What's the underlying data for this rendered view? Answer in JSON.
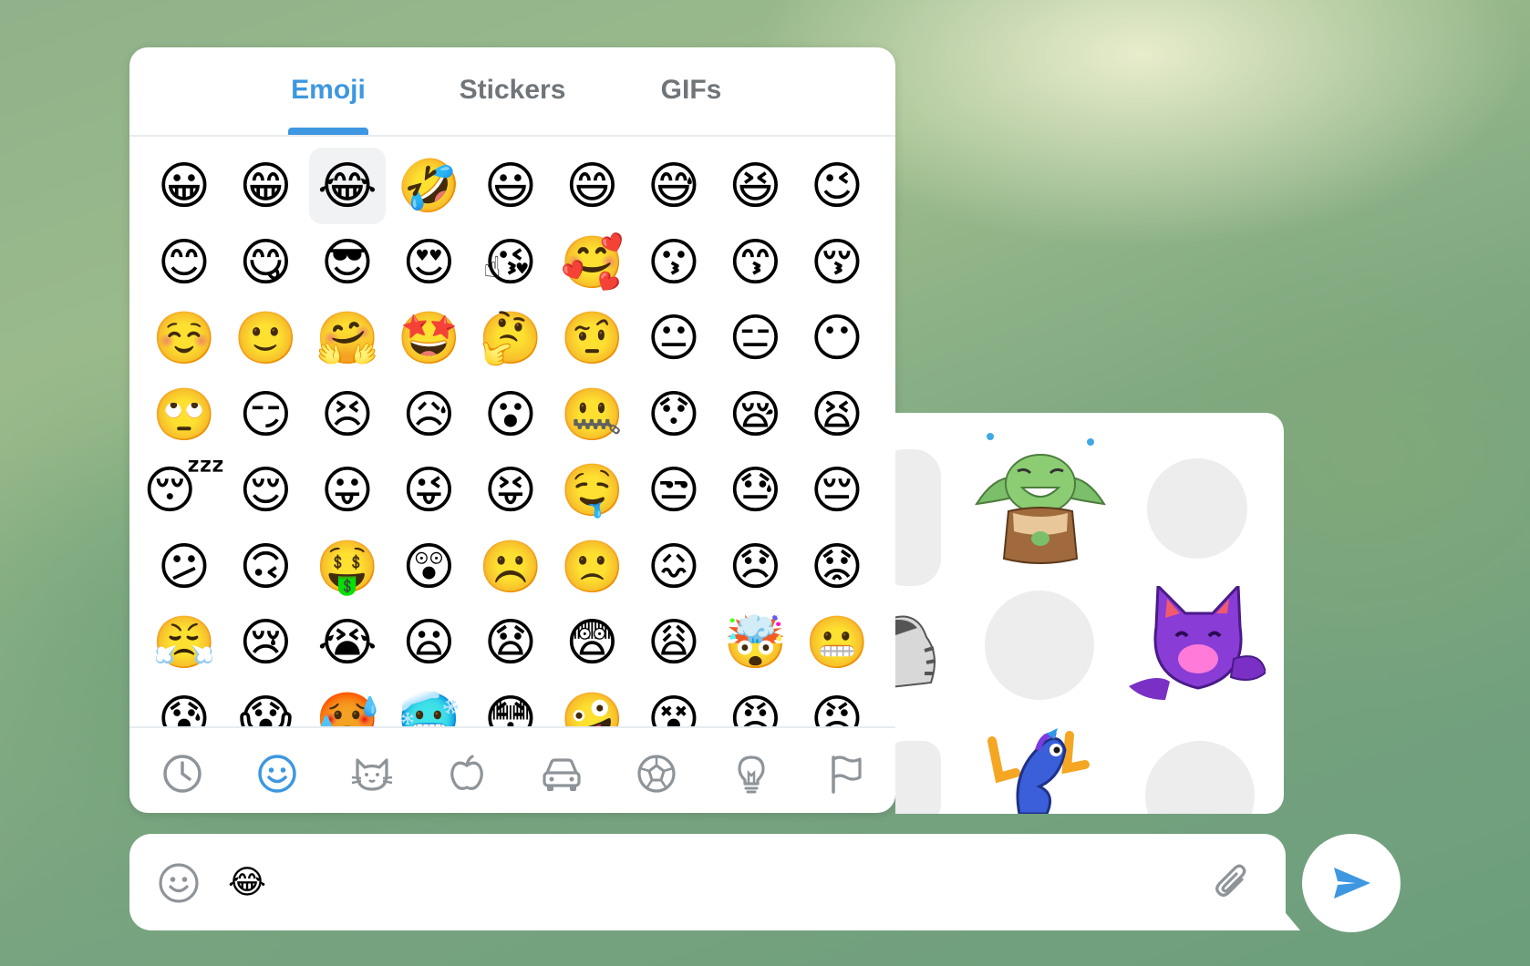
{
  "tabs": [
    {
      "label": "Emoji",
      "active": true
    },
    {
      "label": "Stickers",
      "active": false
    },
    {
      "label": "GIFs",
      "active": false
    }
  ],
  "emoji_grid": [
    [
      "😀",
      "😁",
      "😂",
      "🤣",
      "😃",
      "😄",
      "😅",
      "😆",
      "😉"
    ],
    [
      "😊",
      "😋",
      "😎",
      "😍",
      "😘",
      "🥰",
      "😗",
      "😙",
      "😚"
    ],
    [
      "☺️",
      "🙂",
      "🤗",
      "🤩",
      "🤔",
      "🤨",
      "😐",
      "😑",
      "😶"
    ],
    [
      "🙄",
      "😏",
      "😣",
      "😥",
      "😮",
      "🤐",
      "😯",
      "😪",
      "😫"
    ],
    [
      "😴",
      "😌",
      "😛",
      "😜",
      "😝",
      "🤤",
      "😒",
      "😓",
      "😔"
    ],
    [
      "😕",
      "🙃",
      "🤑",
      "😲",
      "☹️",
      "🙁",
      "😖",
      "😞",
      "😟"
    ],
    [
      "😤",
      "😢",
      "😭",
      "😦",
      "😧",
      "😨",
      "😩",
      "🤯",
      "😬"
    ],
    [
      "😰",
      "😱",
      "🥵",
      "🥶",
      "😳",
      "🤪",
      "😵",
      "😡",
      "😠"
    ]
  ],
  "hovered_emoji": "😂",
  "categories": [
    {
      "name": "recent",
      "active": false
    },
    {
      "name": "smileys",
      "active": true
    },
    {
      "name": "animals",
      "active": false
    },
    {
      "name": "food",
      "active": false
    },
    {
      "name": "travel",
      "active": false
    },
    {
      "name": "activity",
      "active": false
    },
    {
      "name": "objects",
      "active": false
    },
    {
      "name": "flags",
      "active": false
    }
  ],
  "colors": {
    "accent": "#3e97e0",
    "inactive_icon": "#8e9499",
    "tab_inactive": "#707579"
  },
  "composer": {
    "message_value": "😂",
    "placeholder": ""
  }
}
